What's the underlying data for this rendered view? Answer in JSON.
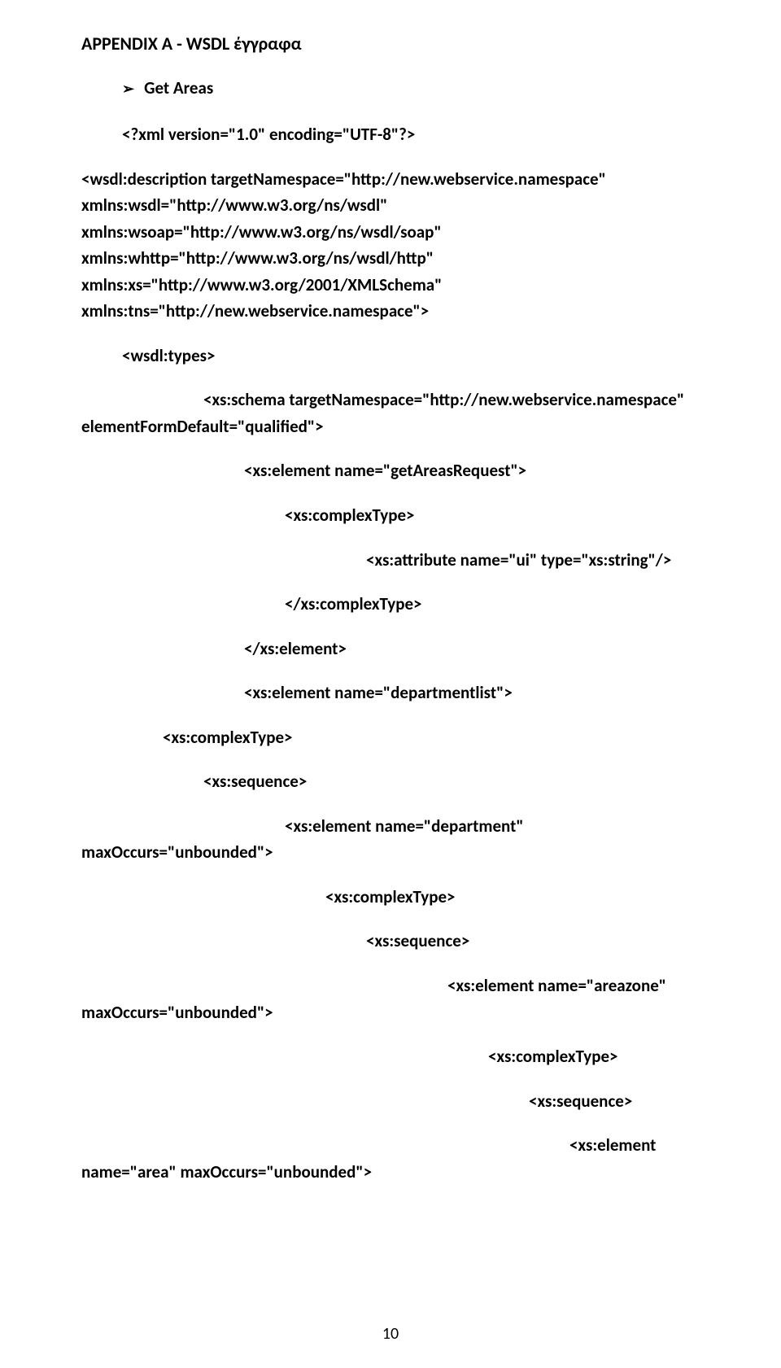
{
  "title": "APPENDIX A - WSDL έγγραφα",
  "bullet": {
    "arrow": "➢",
    "label": "Get Areas"
  },
  "lines": {
    "l1": "<?xml version=\"1.0\" encoding=\"UTF-8\"?>",
    "l2a": "<wsdl:description targetNamespace=\"http://new.webservice.namespace\"",
    "l2b": "xmlns:wsdl=\"http://www.w3.org/ns/wsdl\"",
    "l2c": "xmlns:wsoap=\"http://www.w3.org/ns/wsdl/soap\"",
    "l2d": "xmlns:whttp=\"http://www.w3.org/ns/wsdl/http\"",
    "l2e": "xmlns:xs=\"http://www.w3.org/2001/XMLSchema\"",
    "l2f": "xmlns:tns=\"http://new.webservice.namespace\">",
    "l3": "<wsdl:types>",
    "l4a": "<xs:schema targetNamespace=\"http://new.webservice.namespace\"",
    "l4b": "elementFormDefault=\"qualified\">",
    "l5": "<xs:element name=\"getAreasRequest\">",
    "l6": "<xs:complexType>",
    "l7": "<xs:attribute name=\"ui\" type=\"xs:string\"/>",
    "l8": "</xs:complexType>",
    "l9": "</xs:element>",
    "l10": "<xs:element name=\"departmentlist\">",
    "l11": "<xs:complexType>",
    "l12": "<xs:sequence>",
    "l13a": "<xs:element name=\"department\"",
    "l13b": "maxOccurs=\"unbounded\">",
    "l14": "<xs:complexType>",
    "l15": "<xs:sequence>",
    "l16a": "<xs:element name=\"areazone\"",
    "l16b": "maxOccurs=\"unbounded\">",
    "l17": "<xs:complexType>",
    "l18": "<xs:sequence>",
    "l19a": "<xs:element",
    "l19b": "name=\"area\" maxOccurs=\"unbounded\">"
  },
  "pageNumber": "10"
}
